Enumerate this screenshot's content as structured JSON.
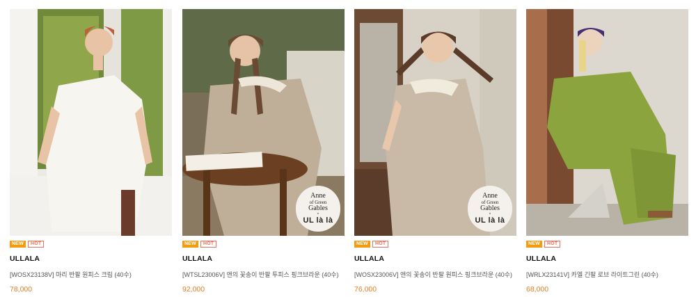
{
  "products": [
    {
      "badges": {
        "new": "NEW",
        "hot": "HOT"
      },
      "brand": "ULLALA",
      "name": "[WOSX23138V] 마리 반팔 원피스 크림 (40수)",
      "price": "78,000"
    },
    {
      "badges": {
        "new": "NEW",
        "hot": "HOT"
      },
      "brand": "ULLALA",
      "name": "[WTSL23006V] 앤의 꽃송이 반팔 투피스 핑크브라운 (40수)",
      "price": "92,000",
      "logo": {
        "line1": "Anne",
        "line2": "of Green",
        "line3": "Gables",
        "line4": "×",
        "line5": "UL là là"
      }
    },
    {
      "badges": {
        "new": "NEW",
        "hot": "HOT"
      },
      "brand": "ULLALA",
      "name": "[WOSX23006V] 앤의 꽃송이 반팔 원피스 핑크브라운 (40수)",
      "price": "76,000",
      "logo": {
        "line1": "Anne",
        "line2": "of Green",
        "line3": "Gables",
        "line4": "×",
        "line5": "UL là là"
      }
    },
    {
      "badges": {
        "new": "NEW",
        "hot": "HOT"
      },
      "brand": "ULLALA",
      "name": "[WRLX23141V] 카엘 긴팔 로브 라이트그린 (40수)",
      "price": "68,000"
    }
  ],
  "colors": {
    "new_badge": "#f39c12",
    "hot_badge": "#e8725c",
    "price": "#e67e22"
  }
}
